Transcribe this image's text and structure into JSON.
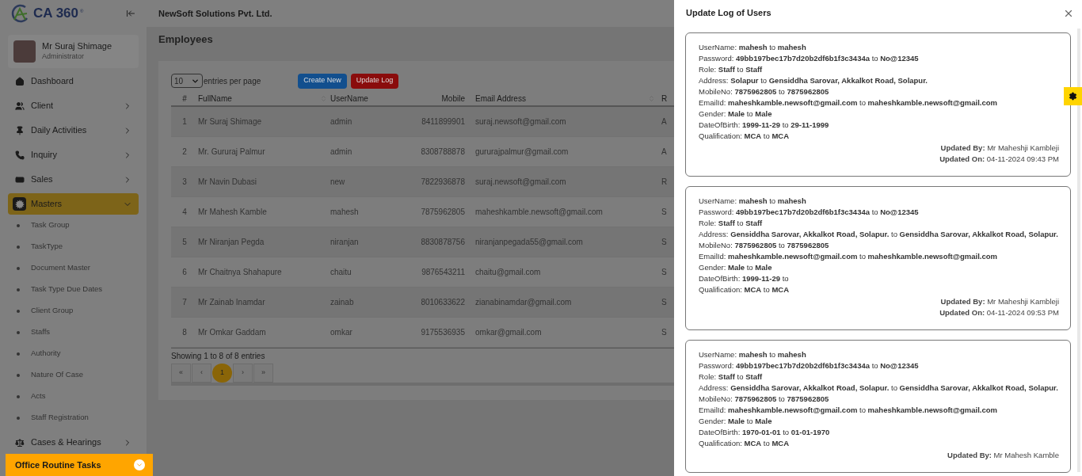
{
  "sidebar": {
    "logo": "CA 360",
    "logo_mark": "®",
    "profile": {
      "name": "Mr Suraj Shimage",
      "role": "Administrator"
    },
    "items": [
      {
        "label": "Dashboard",
        "kind": "link",
        "selected": false
      },
      {
        "label": "Client",
        "kind": "group",
        "selected": false,
        "expanded": false
      },
      {
        "label": "Daily Activities",
        "kind": "group",
        "selected": false,
        "expanded": false
      },
      {
        "label": "Inquiry",
        "kind": "group",
        "selected": false,
        "expanded": false
      },
      {
        "label": "Sales",
        "kind": "group",
        "selected": false,
        "expanded": false
      },
      {
        "label": "Masters",
        "kind": "group",
        "selected": true,
        "expanded": true,
        "children": [
          {
            "label": "Task Group",
            "selected": false
          },
          {
            "label": "TaskType",
            "selected": false
          },
          {
            "label": "Document Master",
            "selected": false
          },
          {
            "label": "Task Type Due Dates",
            "selected": false
          },
          {
            "label": "Client Group",
            "selected": false
          },
          {
            "label": "Staffs",
            "selected": false
          },
          {
            "label": "Authority",
            "selected": false
          },
          {
            "label": "Nature Of Case",
            "selected": false
          },
          {
            "label": "Acts",
            "selected": false
          },
          {
            "label": "Staff Registration",
            "selected": false
          }
        ]
      },
      {
        "label": "Cases & Hearings",
        "kind": "group",
        "selected": false,
        "expanded": false
      }
    ],
    "footer": {
      "label": "Office Routine Tasks",
      "expanded": false
    }
  },
  "header": {
    "company": "NewSoft Solutions Pvt. Ltd."
  },
  "page_title": "Employees",
  "toolbar": {
    "page_size": "10",
    "page_size_label": "entries per page",
    "buttons": [
      {
        "label": "Create New",
        "kind": "primary"
      },
      {
        "label": "Update Log",
        "kind": "danger"
      }
    ]
  },
  "table": {
    "columns": [
      {
        "label": "#",
        "sortable": false
      },
      {
        "label": "FullName",
        "sortable": true
      },
      {
        "label": "UserName",
        "sortable": false
      },
      {
        "label": "Mobile",
        "sortable": false
      },
      {
        "label": "Email Address",
        "sortable": true
      },
      {
        "label": "R"
      }
    ],
    "rows": [
      [
        "1",
        "Mr Suraj Shimage",
        "admin",
        "8411899901",
        "suraj.newsoft@gmail.com",
        "A"
      ],
      [
        "2",
        "Mr. Gururaj Palmur",
        "admin",
        "8308788878",
        "gururajpalmur@gmail.com",
        "A"
      ],
      [
        "3",
        "Mr Navin Dubasi",
        "new",
        "7822936878",
        "suraj.newsoft@gmail.com",
        "R"
      ],
      [
        "4",
        "Mr Mahesh Kamble",
        "mahesh",
        "7875962805",
        "maheshkamble.newsoft@gmail.com",
        "S"
      ],
      [
        "5",
        "Mr Niranjan Pegda",
        "niranjan",
        "8830878756",
        "niranjanpegada55@gmail.com",
        "S"
      ],
      [
        "6",
        "Mr Chaitnya Shahapure",
        "chaitu",
        "9876543211",
        "chaitu@gmail.com",
        "S"
      ],
      [
        "7",
        "Mr Zainab Inamdar",
        "zainab",
        "8010633622",
        "zianabinamdar@gmail.com",
        "S"
      ],
      [
        "8",
        "Mr Omkar Gaddam",
        "omkar",
        "9175536935",
        "omkar@gmail.com",
        "S"
      ]
    ],
    "info": "Showing 1 to 8 of 8 entries"
  },
  "pagination": [
    {
      "label": "«",
      "selected": false
    },
    {
      "label": "‹",
      "selected": false
    },
    {
      "label": "1",
      "selected": true
    },
    {
      "label": "›",
      "selected": false
    },
    {
      "label": "»",
      "selected": false
    }
  ],
  "drawer": {
    "title": "Update Log of Users",
    "logs": [
      {
        "lines": [
          "UserName: **mahesh** to **mahesh**",
          "Password: **49bb197bec17b7d20b2df6b1f3c3434a** to **No@12345**",
          "Role: **Staff** to **Staff**",
          "Address: **Solapur** to **Gensiddha Sarovar, Akkalkot Road, Solapur.**",
          "MobileNo: **7875962805** to **7875962805**",
          "EmailId: **maheshkamble.newsoft@gmail.com** to **maheshkamble.newsoft@gmail.com**",
          "Gender: **Male** to **Male**",
          "DateOfBirth: **1999-11-29** to **29-11-1999**",
          "Qualification: **MCA** to **MCA**"
        ],
        "footer": [
          "**Updated By:** Mr Maheshji Kambleji",
          "**Updated On:** 04-11-2024 09:43 PM"
        ]
      },
      {
        "lines": [
          "UserName: **mahesh** to **mahesh**",
          "Password: **49bb197bec17b7d20b2df6b1f3c3434a** to **No@12345**",
          "Role: **Staff** to **Staff**",
          "Address: **Gensiddha Sarovar, Akkalkot Road, Solapur.** to **Gensiddha Sarovar, Akkalkot Road, Solapur.**",
          "MobileNo: **7875962805** to **7875962805**",
          "EmailId: **maheshkamble.newsoft@gmail.com** to **maheshkamble.newsoft@gmail.com**",
          "Gender: **Male** to **Male**",
          "DateOfBirth: **1999-11-29** to",
          "Qualification: **MCA** to **MCA**"
        ],
        "footer": [
          "**Updated By:** Mr Maheshji Kambleji",
          "**Updated On:** 04-11-2024 09:53 PM"
        ]
      },
      {
        "lines": [
          "UserName: **mahesh** to **mahesh**",
          "Password: **49bb197bec17b7d20b2df6b1f3c3434a** to **No@12345**",
          "Role: **Staff** to **Staff**",
          "Address: **Gensiddha Sarovar, Akkalkot Road, Solapur.** to **Gensiddha Sarovar, Akkalkot Road, Solapur.**",
          "MobileNo: **7875962805** to **7875962805**",
          "EmailId: **maheshkamble.newsoft@gmail.com** to **maheshkamble.newsoft@gmail.com**",
          "Gender: **Male** to **Male**",
          "DateOfBirth: **1970-01-01** to **01-01-1970**",
          "Qualification: **MCA** to **MCA**"
        ],
        "footer": [
          "**Updated By:** Mr Mahesh Kamble"
        ]
      }
    ]
  }
}
